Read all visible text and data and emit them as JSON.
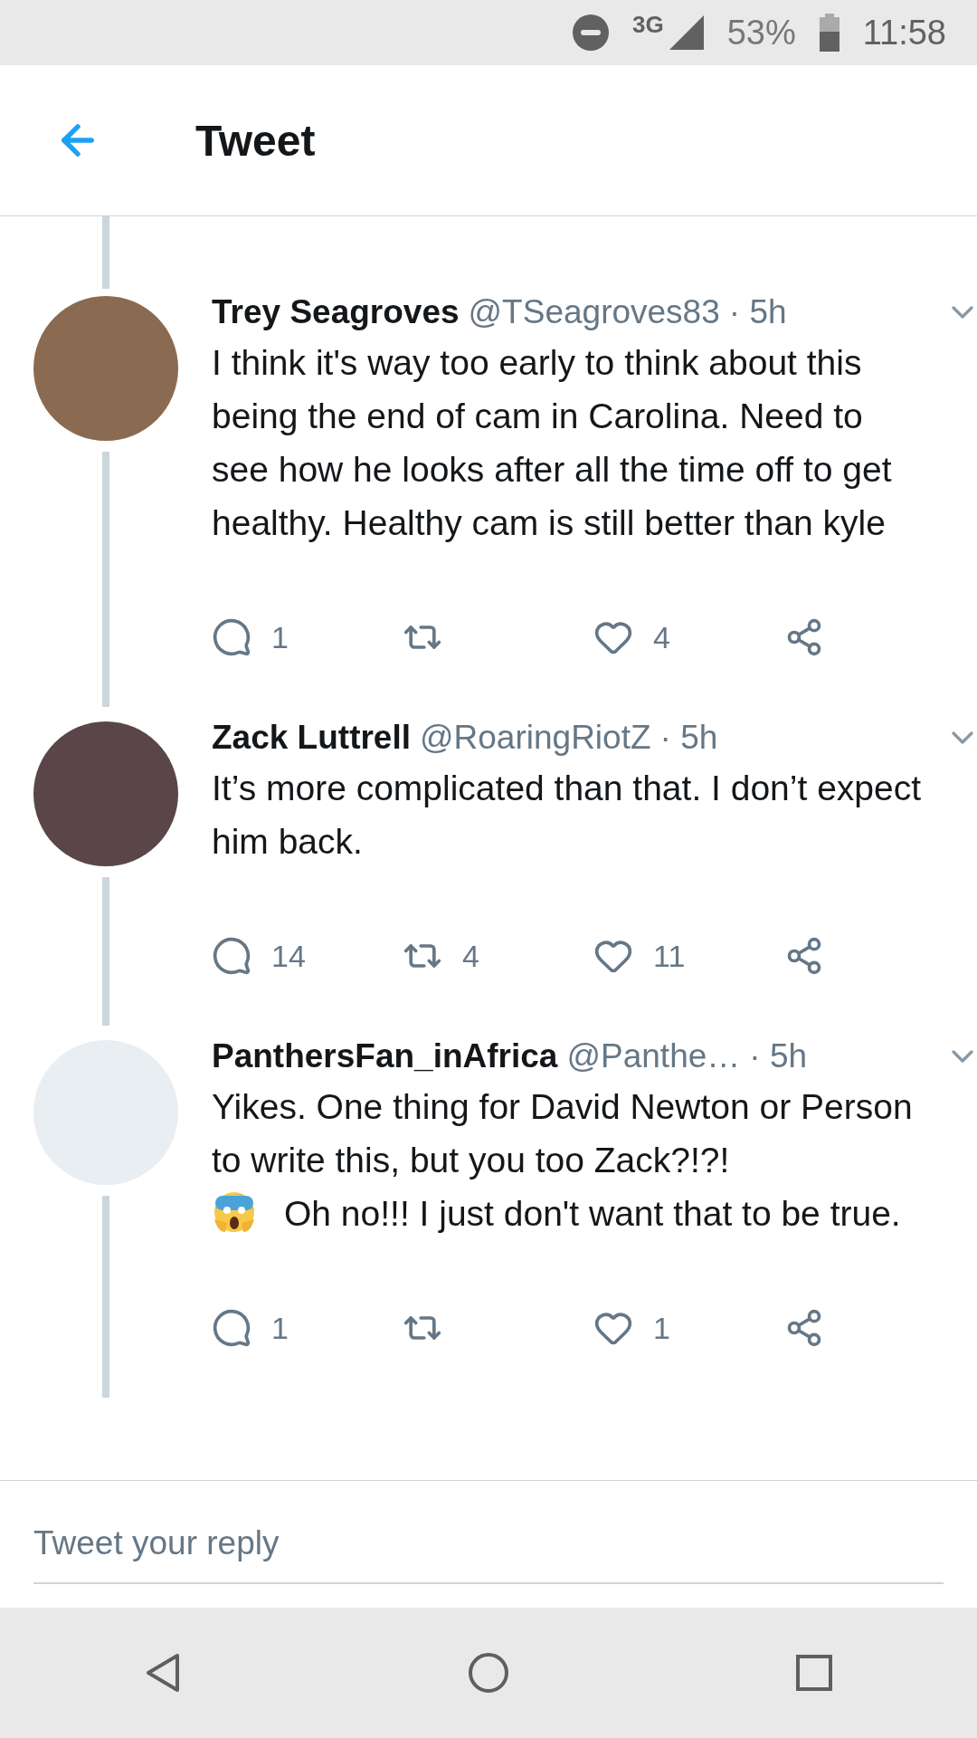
{
  "status_bar": {
    "network": "3G",
    "battery": "53%",
    "time": "11:58"
  },
  "header": {
    "title": "Tweet"
  },
  "tweets": [
    {
      "name": "Trey Seagroves",
      "handle": "@TSeagroves83",
      "time": "· 5h",
      "body": [
        {
          "kind": "text",
          "text": "I think it's way too early to think about this being the end of cam in Carolina. Need to see how he looks after all the time off to get healthy. Healthy cam is still better than kyle"
        }
      ],
      "replies": "1",
      "likes": "4"
    },
    {
      "name": "Zack Luttrell",
      "handle": "@RoaringRiotZ",
      "time": "· 5h",
      "body": [
        {
          "kind": "text",
          "text": "It’s more complicated than that. I don’t expect him back."
        }
      ],
      "replies": "14",
      "retweets": "4",
      "likes": "11"
    },
    {
      "name": "PanthersFan_inAfrica",
      "handle": "@Panthe…",
      "time": "· 5h",
      "body": [
        {
          "kind": "text",
          "text": "Yikes. One thing for David Newton or Person to write this, but you too Zack?!?!"
        },
        {
          "kind": "emoji"
        },
        {
          "kind": "text",
          "text": "Oh no!!! I just don't want that to be true."
        }
      ],
      "replies": "1",
      "likes": "1"
    }
  ],
  "reply": {
    "placeholder": "Tweet your reply"
  }
}
